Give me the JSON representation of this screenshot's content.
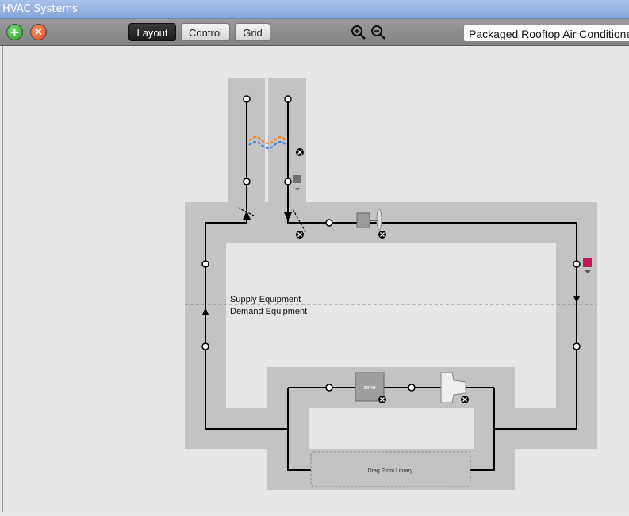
{
  "window": {
    "title": "HVAC Systems"
  },
  "toolbar": {
    "add_icon": "plus-icon",
    "remove_icon": "x-icon",
    "tabs": [
      {
        "label": "Layout",
        "selected": true
      },
      {
        "label": "Control",
        "selected": false
      },
      {
        "label": "Grid",
        "selected": false
      }
    ],
    "zoom_in_icon": "zoom-in-icon",
    "zoom_out_icon": "zoom-out-icon",
    "system_select": "Packaged Rooftop Air Conditioner"
  },
  "canvas": {
    "supply_label": "Supply Equipment",
    "demand_label": "Demand Equipment",
    "zone_label": "zone",
    "drop_zone_label": "Drag From Library",
    "colors": {
      "panel": "#c3c3c3",
      "background": "#e6e6e6",
      "setpoint_manager": "#c2185b",
      "coil_hot": "#ff7b1a",
      "coil_cold": "#3d7fe0"
    }
  }
}
